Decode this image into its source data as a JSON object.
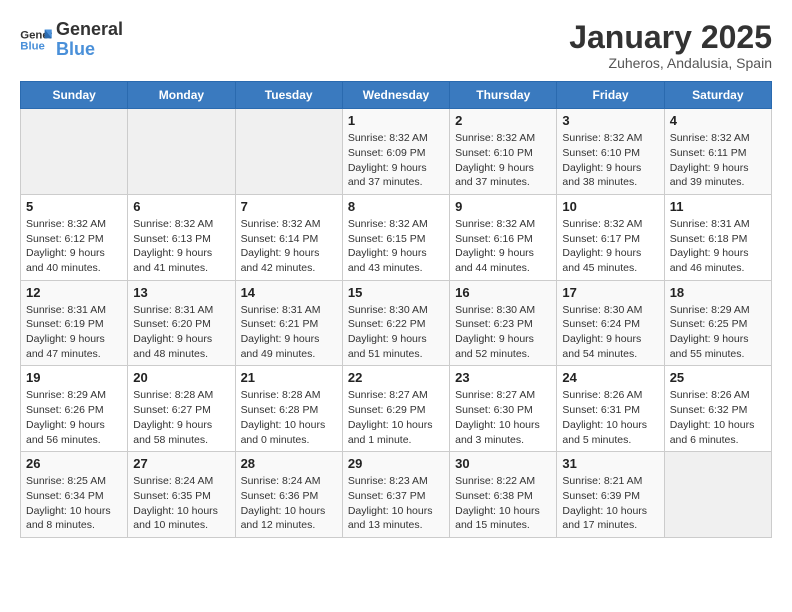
{
  "header": {
    "logo_line1": "General",
    "logo_line2": "Blue",
    "title": "January 2025",
    "subtitle": "Zuheros, Andalusia, Spain"
  },
  "weekdays": [
    "Sunday",
    "Monday",
    "Tuesday",
    "Wednesday",
    "Thursday",
    "Friday",
    "Saturday"
  ],
  "weeks": [
    [
      {
        "day": "",
        "info": ""
      },
      {
        "day": "",
        "info": ""
      },
      {
        "day": "",
        "info": ""
      },
      {
        "day": "1",
        "info": "Sunrise: 8:32 AM\nSunset: 6:09 PM\nDaylight: 9 hours\nand 37 minutes."
      },
      {
        "day": "2",
        "info": "Sunrise: 8:32 AM\nSunset: 6:10 PM\nDaylight: 9 hours\nand 37 minutes."
      },
      {
        "day": "3",
        "info": "Sunrise: 8:32 AM\nSunset: 6:10 PM\nDaylight: 9 hours\nand 38 minutes."
      },
      {
        "day": "4",
        "info": "Sunrise: 8:32 AM\nSunset: 6:11 PM\nDaylight: 9 hours\nand 39 minutes."
      }
    ],
    [
      {
        "day": "5",
        "info": "Sunrise: 8:32 AM\nSunset: 6:12 PM\nDaylight: 9 hours\nand 40 minutes."
      },
      {
        "day": "6",
        "info": "Sunrise: 8:32 AM\nSunset: 6:13 PM\nDaylight: 9 hours\nand 41 minutes."
      },
      {
        "day": "7",
        "info": "Sunrise: 8:32 AM\nSunset: 6:14 PM\nDaylight: 9 hours\nand 42 minutes."
      },
      {
        "day": "8",
        "info": "Sunrise: 8:32 AM\nSunset: 6:15 PM\nDaylight: 9 hours\nand 43 minutes."
      },
      {
        "day": "9",
        "info": "Sunrise: 8:32 AM\nSunset: 6:16 PM\nDaylight: 9 hours\nand 44 minutes."
      },
      {
        "day": "10",
        "info": "Sunrise: 8:32 AM\nSunset: 6:17 PM\nDaylight: 9 hours\nand 45 minutes."
      },
      {
        "day": "11",
        "info": "Sunrise: 8:31 AM\nSunset: 6:18 PM\nDaylight: 9 hours\nand 46 minutes."
      }
    ],
    [
      {
        "day": "12",
        "info": "Sunrise: 8:31 AM\nSunset: 6:19 PM\nDaylight: 9 hours\nand 47 minutes."
      },
      {
        "day": "13",
        "info": "Sunrise: 8:31 AM\nSunset: 6:20 PM\nDaylight: 9 hours\nand 48 minutes."
      },
      {
        "day": "14",
        "info": "Sunrise: 8:31 AM\nSunset: 6:21 PM\nDaylight: 9 hours\nand 49 minutes."
      },
      {
        "day": "15",
        "info": "Sunrise: 8:30 AM\nSunset: 6:22 PM\nDaylight: 9 hours\nand 51 minutes."
      },
      {
        "day": "16",
        "info": "Sunrise: 8:30 AM\nSunset: 6:23 PM\nDaylight: 9 hours\nand 52 minutes."
      },
      {
        "day": "17",
        "info": "Sunrise: 8:30 AM\nSunset: 6:24 PM\nDaylight: 9 hours\nand 54 minutes."
      },
      {
        "day": "18",
        "info": "Sunrise: 8:29 AM\nSunset: 6:25 PM\nDaylight: 9 hours\nand 55 minutes."
      }
    ],
    [
      {
        "day": "19",
        "info": "Sunrise: 8:29 AM\nSunset: 6:26 PM\nDaylight: 9 hours\nand 56 minutes."
      },
      {
        "day": "20",
        "info": "Sunrise: 8:28 AM\nSunset: 6:27 PM\nDaylight: 9 hours\nand 58 minutes."
      },
      {
        "day": "21",
        "info": "Sunrise: 8:28 AM\nSunset: 6:28 PM\nDaylight: 10 hours\nand 0 minutes."
      },
      {
        "day": "22",
        "info": "Sunrise: 8:27 AM\nSunset: 6:29 PM\nDaylight: 10 hours\nand 1 minute."
      },
      {
        "day": "23",
        "info": "Sunrise: 8:27 AM\nSunset: 6:30 PM\nDaylight: 10 hours\nand 3 minutes."
      },
      {
        "day": "24",
        "info": "Sunrise: 8:26 AM\nSunset: 6:31 PM\nDaylight: 10 hours\nand 5 minutes."
      },
      {
        "day": "25",
        "info": "Sunrise: 8:26 AM\nSunset: 6:32 PM\nDaylight: 10 hours\nand 6 minutes."
      }
    ],
    [
      {
        "day": "26",
        "info": "Sunrise: 8:25 AM\nSunset: 6:34 PM\nDaylight: 10 hours\nand 8 minutes."
      },
      {
        "day": "27",
        "info": "Sunrise: 8:24 AM\nSunset: 6:35 PM\nDaylight: 10 hours\nand 10 minutes."
      },
      {
        "day": "28",
        "info": "Sunrise: 8:24 AM\nSunset: 6:36 PM\nDaylight: 10 hours\nand 12 minutes."
      },
      {
        "day": "29",
        "info": "Sunrise: 8:23 AM\nSunset: 6:37 PM\nDaylight: 10 hours\nand 13 minutes."
      },
      {
        "day": "30",
        "info": "Sunrise: 8:22 AM\nSunset: 6:38 PM\nDaylight: 10 hours\nand 15 minutes."
      },
      {
        "day": "31",
        "info": "Sunrise: 8:21 AM\nSunset: 6:39 PM\nDaylight: 10 hours\nand 17 minutes."
      },
      {
        "day": "",
        "info": ""
      }
    ]
  ]
}
